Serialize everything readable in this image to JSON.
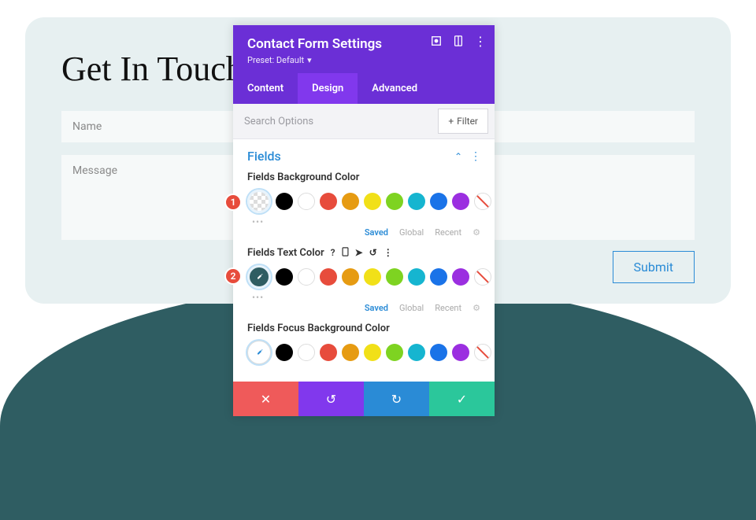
{
  "page": {
    "heading": "Get In Touch",
    "name_placeholder": "Name",
    "message_placeholder": "Message",
    "submit_label": "Submit"
  },
  "panel": {
    "title": "Contact Form Settings",
    "preset_label": "Preset: Default",
    "tabs": {
      "content": "Content",
      "design": "Design",
      "advanced": "Advanced"
    },
    "search_placeholder": "Search Options",
    "filter_label": "Filter",
    "section_title": "Fields",
    "options": {
      "bg": {
        "label": "Fields Background Color"
      },
      "text": {
        "label": "Fields Text Color"
      },
      "focus": {
        "label": "Fields Focus Background Color"
      }
    },
    "meta": {
      "saved": "Saved",
      "global": "Global",
      "recent": "Recent"
    }
  },
  "swatch_colors": {
    "black": "#000000",
    "red": "#e74c3c",
    "orange": "#e69b12",
    "yellow": "#f1e018",
    "green": "#7ed321",
    "cyan": "#16b5d0",
    "blue": "#1a73e8",
    "purple": "#9b2fe0"
  },
  "badges": {
    "one": "1",
    "two": "2"
  }
}
